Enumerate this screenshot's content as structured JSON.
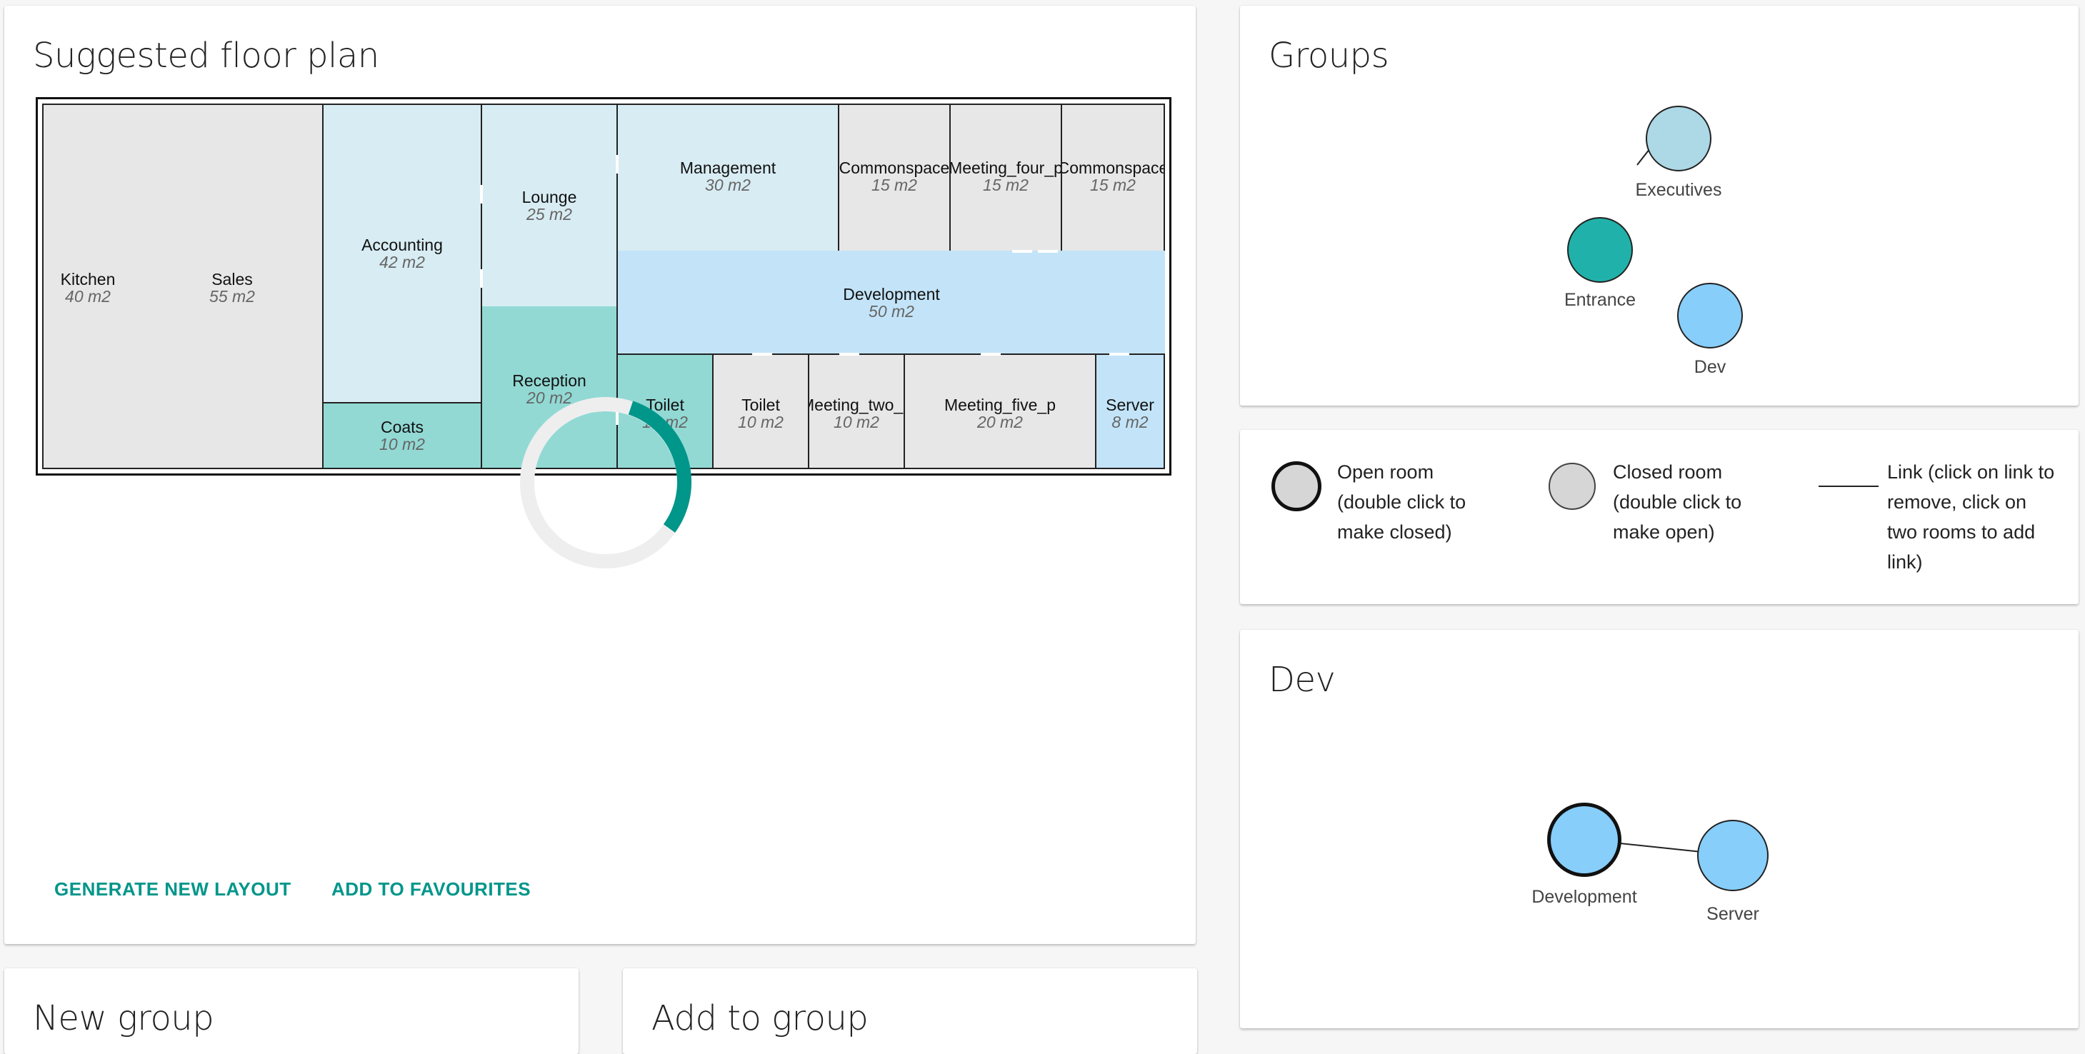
{
  "floorplan": {
    "title": "Suggested floor plan",
    "rooms": [
      {
        "name": "Kitchen",
        "size": "40 m2"
      },
      {
        "name": "Sales",
        "size": "55 m2"
      },
      {
        "name": "Accounting",
        "size": "42 m2"
      },
      {
        "name": "Coats",
        "size": "10 m2"
      },
      {
        "name": "Lounge",
        "size": "25 m2"
      },
      {
        "name": "Reception",
        "size": "20 m2"
      },
      {
        "name": "Management",
        "size": "30 m2"
      },
      {
        "name": "Commonspace",
        "size": "15 m2"
      },
      {
        "name": "Meeting_four_p",
        "size": "15 m2"
      },
      {
        "name": "Commonspace",
        "size": "15 m2"
      },
      {
        "name": "Development",
        "size": "50 m2"
      },
      {
        "name": "Toilet",
        "size": "10 m2"
      },
      {
        "name": "Toilet",
        "size": "10 m2"
      },
      {
        "name": "Meeting_two_p",
        "size": "10 m2"
      },
      {
        "name": "Meeting_five_p",
        "size": "20 m2"
      },
      {
        "name": "Server",
        "size": "8 m2"
      }
    ],
    "actions": {
      "generate": "GENERATE NEW LAYOUT",
      "favourite": "ADD TO FAVOURITES"
    }
  },
  "groups": {
    "title": "Groups",
    "nodes": [
      {
        "label": "Executives",
        "color": "#add8e6"
      },
      {
        "label": "Entrance",
        "color": "#20b2aa"
      },
      {
        "label": "Dev",
        "color": "#87cefa"
      }
    ]
  },
  "legend": {
    "open_room": "Open room (double click to make closed)",
    "closed_room": "Closed room (double click to make open)",
    "link": "Link (click on link to remove, click on two rooms to add link)"
  },
  "dev_group": {
    "title": "Dev",
    "nodes": [
      {
        "label": "Development",
        "color": "#87cefa"
      },
      {
        "label": "Server",
        "color": "#87cefa"
      }
    ]
  },
  "new_group": {
    "title": "New group"
  },
  "add_to_group": {
    "title": "Add to group"
  },
  "colors": {
    "accent": "#00968a",
    "room_grey": "#e7e7e7",
    "exec_blue": "#d8ecf3",
    "entrance_teal": "#92d9d4",
    "dev_blue": "#c3e4f8"
  }
}
